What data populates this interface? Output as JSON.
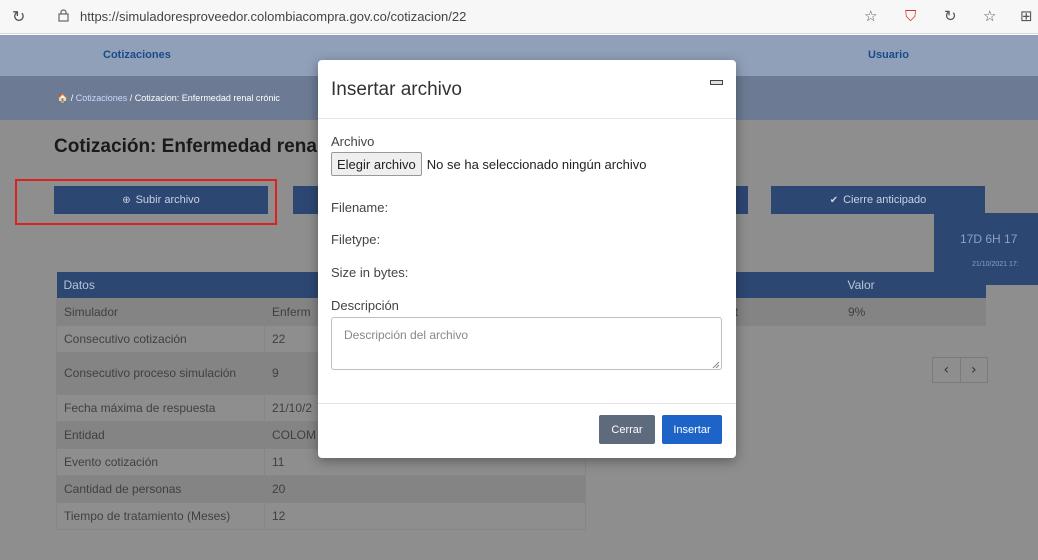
{
  "browser": {
    "reload_icon": "↻",
    "url": "https://simuladoresproveedor.colombiacompra.gov.co/cotizacion/22",
    "icons": [
      "☆",
      "⛉",
      "↻",
      "☆",
      "⊞"
    ]
  },
  "navbar": {
    "left_link": "Cotizaciones",
    "right_link": "Usuario"
  },
  "breadcrumb": {
    "home_icon": "🏠",
    "sep1": " / ",
    "link": "Cotizaciones",
    "sep2": " / ",
    "current": "Cotizacion: Enfermedad renal crónic"
  },
  "page": {
    "title": "Cotización: Enfermedad rena",
    "upload_button": "Subir archivo",
    "close_early_button": "Cierre anticipado",
    "timer": "17D 6H 17",
    "timer_date": "21/10/2021 17:"
  },
  "table": {
    "header": "Datos",
    "rows": [
      {
        "label": "Simulador",
        "value": "Enferm"
      },
      {
        "label": "Consecutivo cotización",
        "value": "22"
      },
      {
        "label": "Consecutivo proceso simulación",
        "value": "9"
      },
      {
        "label": "Fecha máxima de respuesta",
        "value": "21/10/2"
      },
      {
        "label": "Entidad",
        "value": "COLOM"
      },
      {
        "label": "Evento cotización",
        "value": "11"
      },
      {
        "label": "Cantidad de personas",
        "value": "20"
      },
      {
        "label": "Tiempo de tratamiento (Meses)",
        "value": "12"
      }
    ]
  },
  "table2": {
    "header": "Valor",
    "row_label": "ot",
    "row_value": "9%"
  },
  "pager": {
    "prev": "‹",
    "next": "›"
  },
  "modal": {
    "title": "Insertar archivo",
    "file_label": "Archivo",
    "file_button": "Elegir archivo",
    "file_status": "No se ha seleccionado ningún archivo",
    "filename_label": "Filename:",
    "filetype_label": "Filetype:",
    "size_label": "Size in bytes:",
    "description_label": "Descripción",
    "description_placeholder": "Descripción del archivo",
    "close_button": "Cerrar",
    "insert_button": "Insertar"
  },
  "colors": {
    "overlay": "#8e8e8e",
    "primary": "#1e64c8",
    "dark_blue": "#2d4773",
    "highlight": "#e02020"
  }
}
